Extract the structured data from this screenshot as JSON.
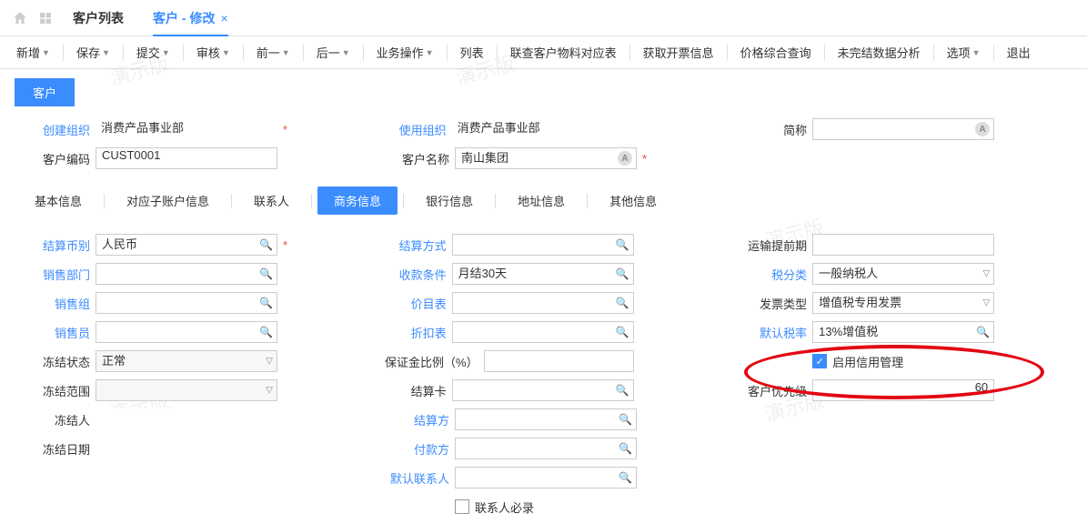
{
  "topTabs": {
    "list": "客户列表",
    "edit": "客户 - 修改"
  },
  "toolbar": {
    "new": "新增",
    "save": "保存",
    "submit": "提交",
    "audit": "审核",
    "prev": "前一",
    "next": "后一",
    "bizop": "业务操作",
    "listbtn": "列表",
    "crossref": "联查客户物料对应表",
    "invoice": "获取开票信息",
    "pricequery": "价格综合查询",
    "unsettled": "未完结数据分析",
    "options": "选项",
    "exit": "退出"
  },
  "sectionTab": "客户",
  "header": {
    "createOrgLabel": "创建组织",
    "createOrg": "消费产品事业部",
    "useOrgLabel": "使用组织",
    "useOrg": "消费产品事业部",
    "shortNameLabel": "简称",
    "shortName": "",
    "codeLabel": "客户编码",
    "code": "CUST0001",
    "nameLabel": "客户名称",
    "name": "南山集团"
  },
  "innerTabs": {
    "basic": "基本信息",
    "subacct": "对应子账户信息",
    "contact": "联系人",
    "biz": "商务信息",
    "bank": "银行信息",
    "addr": "地址信息",
    "other": "其他信息"
  },
  "biz": {
    "currencyLabel": "结算币别",
    "currency": "人民币",
    "settleTypeLabel": "结算方式",
    "settleType": "",
    "shipLeadLabel": "运输提前期",
    "shipLead": "",
    "salesDeptLabel": "销售部门",
    "salesDept": "",
    "payTermLabel": "收款条件",
    "payTerm": "月结30天",
    "taxCatLabel": "税分类",
    "taxCat": "一般纳税人",
    "salesGroupLabel": "销售组",
    "salesGroup": "",
    "priceListLabel": "价目表",
    "priceList": "",
    "invoiceTypeLabel": "发票类型",
    "invoiceType": "增值税专用发票",
    "salesmanLabel": "销售员",
    "salesman": "",
    "discountLabel": "折扣表",
    "discount": "",
    "defTaxLabel": "默认税率",
    "defTax": "13%增值税",
    "freezeStateLabel": "冻结状态",
    "freezeState": "正常",
    "depositRatioLabel": "保证金比例（%）",
    "depositRatio": "",
    "creditMgmtLabel": "启用信用管理",
    "freezeScopeLabel": "冻结范围",
    "freezeScope": "",
    "settleCardLabel": "结算卡",
    "settleCard": "",
    "priorityLabel": "客户优先级",
    "priority": "60",
    "freezerLabel": "冻结人",
    "freezer": "",
    "settlePartyLabel": "结算方",
    "settleParty": "",
    "freezeDateLabel": "冻结日期",
    "freezeDate": "",
    "payerLabel": "付款方",
    "payer": "",
    "defContactLabel": "默认联系人",
    "defContact": "",
    "contactRequiredLabel": "联系人必录"
  },
  "watermark": "演示版"
}
